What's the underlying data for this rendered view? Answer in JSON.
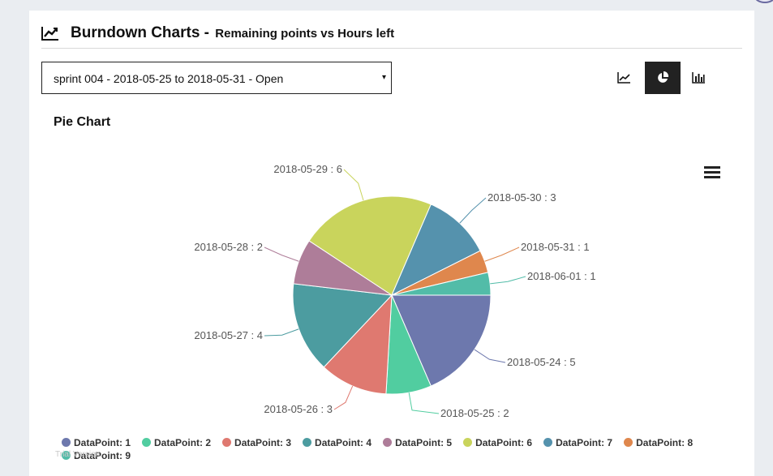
{
  "header": {
    "icon": "line-chart-icon",
    "title": "Burndown Charts -",
    "subtitle": "Remaining points vs Hours left"
  },
  "sprint_select": {
    "value": "sprint 004 - 2018-05-25 to 2018-05-31 - Open",
    "arrow": "▾"
  },
  "view_buttons": [
    {
      "icon": "line-chart-icon",
      "active": false
    },
    {
      "icon": "pie-chart-icon",
      "active": true
    },
    {
      "icon": "bar-chart-icon",
      "active": false
    }
  ],
  "chart_heading": "Pie Chart",
  "credit": "Trial Version",
  "chart_data": {
    "type": "pie",
    "labels": [
      "2018-05-24",
      "2018-05-25",
      "2018-05-26",
      "2018-05-27",
      "2018-05-28",
      "2018-05-29",
      "2018-05-30",
      "2018-05-31",
      "2018-06-01"
    ],
    "values": [
      5,
      2,
      3,
      4,
      2,
      6,
      3,
      1,
      1
    ],
    "slice_labels": [
      "2018-05-24 : 5",
      "2018-05-25 : 2",
      "2018-05-26 : 3",
      "2018-05-27 : 4",
      "2018-05-28 : 2",
      "2018-05-29 : 6",
      "2018-05-30 : 3",
      "2018-05-31 : 1",
      "2018-06-01 : 1"
    ],
    "colors": [
      "#6d78ad",
      "#51cda0",
      "#df7970",
      "#4c9ca0",
      "#ae7d99",
      "#c9d45c",
      "#5592ad",
      "#df874d",
      "#52bca8"
    ],
    "legend": [
      "DataPoint: 1",
      "DataPoint: 2",
      "DataPoint: 3",
      "DataPoint: 4",
      "DataPoint: 5",
      "DataPoint: 6",
      "DataPoint: 7",
      "DataPoint: 8",
      "DataPoint: 9"
    ],
    "legend_placement": "bottom"
  }
}
